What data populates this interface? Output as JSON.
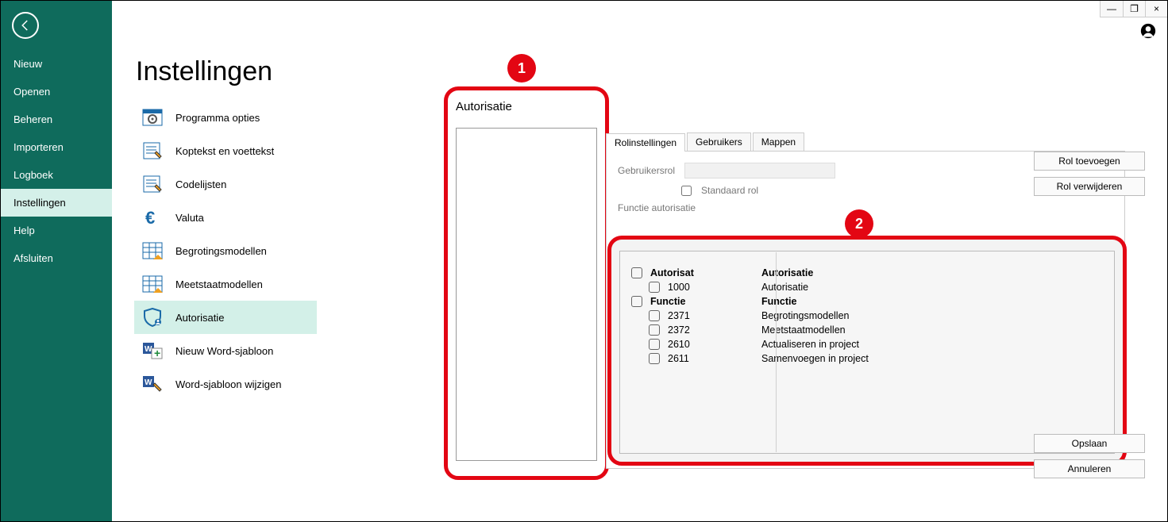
{
  "window_controls": {
    "minimize": "—",
    "maximize": "❐",
    "close": "×"
  },
  "sidebar": {
    "items": [
      {
        "label": "Nieuw"
      },
      {
        "label": "Openen"
      },
      {
        "label": "Beheren"
      },
      {
        "label": "Importeren"
      },
      {
        "label": "Logboek"
      },
      {
        "label": "Instellingen",
        "active": true
      },
      {
        "label": "Help"
      },
      {
        "label": "Afsluiten"
      }
    ]
  },
  "page_title": "Instellingen",
  "settings_items": [
    {
      "label": "Programma opties"
    },
    {
      "label": "Koptekst en voettekst"
    },
    {
      "label": "Codelijsten"
    },
    {
      "label": "Valuta"
    },
    {
      "label": "Begrotingsmodellen"
    },
    {
      "label": "Meetstaatmodellen"
    },
    {
      "label": "Autorisatie",
      "active": true
    },
    {
      "label": "Nieuw Word-sjabloon"
    },
    {
      "label": "Word-sjabloon wijzigen"
    }
  ],
  "panel1": {
    "title": "Autorisatie"
  },
  "tabs": [
    {
      "label": "Rolinstellingen",
      "active": true
    },
    {
      "label": "Gebruikers"
    },
    {
      "label": "Mappen"
    }
  ],
  "form": {
    "role_label": "Gebruikersrol",
    "role_value": "",
    "default_label": "Standaard rol",
    "fieldset_label": "Functie autorisatie"
  },
  "grid": {
    "groups": [
      {
        "header_code": "Autorisat",
        "header_desc": "Autorisatie",
        "rows": [
          {
            "code": "1000",
            "desc": "Autorisatie"
          }
        ]
      },
      {
        "header_code": "Functie",
        "header_desc": "Functie",
        "rows": [
          {
            "code": "2371",
            "desc": "Begrotingsmodellen"
          },
          {
            "code": "2372",
            "desc": "Meetstaatmodellen"
          },
          {
            "code": "2610",
            "desc": "Actualiseren in project"
          },
          {
            "code": "2611",
            "desc": "Samenvoegen in project"
          }
        ]
      }
    ]
  },
  "buttons": {
    "add_role": "Rol toevoegen",
    "remove_role": "Rol verwijderen",
    "save": "Opslaan",
    "cancel": "Annuleren"
  },
  "badges": {
    "one": "1",
    "two": "2"
  }
}
